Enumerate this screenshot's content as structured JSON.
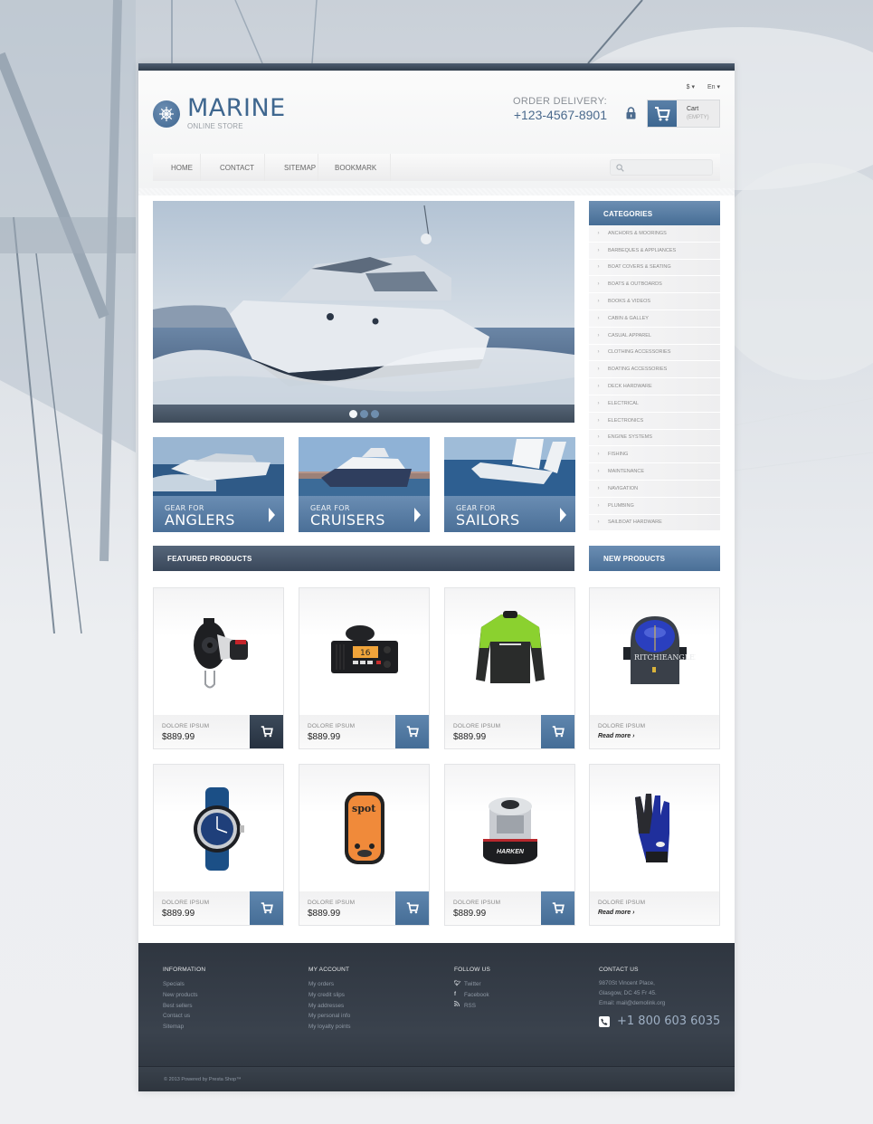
{
  "header": {
    "currency": "$",
    "language": "En",
    "logo_title": "MARINE",
    "logo_subtitle": "ONLINE STORE",
    "delivery_label": "ORDER DELIVERY:",
    "delivery_phone": "+123-4567-8901",
    "cart_label": "Cart",
    "cart_status": "(EMPTY)"
  },
  "nav": {
    "items": [
      "HOME",
      "CONTACT",
      "SITEMAP",
      "BOOKMARK"
    ],
    "search_placeholder": ""
  },
  "slider": {
    "slides": 3,
    "active_slide": 1
  },
  "banners": [
    {
      "small": "GEAR FOR",
      "big": "ANGLERS"
    },
    {
      "small": "GEAR FOR",
      "big": "CRUISERS"
    },
    {
      "small": "GEAR FOR",
      "big": "SAILORS"
    }
  ],
  "categories": {
    "title": "CATEGORIES",
    "items": [
      "ANCHORS & MOORINGS",
      "BARBEQUES & APPLIANCES",
      "BOAT COVERS & SEATING",
      "BOATS & OUTBOARDS",
      "BOOKS & VIDEOS",
      "CABIN & GALLEY",
      "CASUAL APPAREL",
      "CLOTHING ACCESSORIES",
      "BOATING ACCESSORIES",
      "DECK HARDWARE",
      "ELECTRICAL",
      "ELECTRONICS",
      "ENGINE SYSTEMS",
      "FISHING",
      "MAINTENANCE",
      "NAVIGATION",
      "PLUMBING",
      "SAILBOAT HARDWARE"
    ]
  },
  "featured": {
    "title": "FEATURED PRODUCTS",
    "products": [
      {
        "name": "DOLORE IPSUM",
        "price": "$889.99",
        "image": "block-pulley"
      },
      {
        "name": "DOLORE IPSUM",
        "price": "$889.99",
        "image": "vhf-radio"
      },
      {
        "name": "DOLORE IPSUM",
        "price": "$889.99",
        "image": "sailing-jacket"
      },
      {
        "name": "DOLORE IPSUM",
        "price": "$889.99",
        "image": "dive-watch"
      },
      {
        "name": "DOLORE IPSUM",
        "price": "$889.99",
        "image": "spot-gps-messenger"
      },
      {
        "name": "DOLORE IPSUM",
        "price": "$889.99",
        "image": "winch"
      }
    ]
  },
  "new_products": {
    "title": "NEW PRODUCTS",
    "products": [
      {
        "name": "DOLORE IPSUM",
        "link": "Read more ›",
        "image": "ritchie-compass"
      },
      {
        "name": "DOLORE IPSUM",
        "link": "Read more ›",
        "image": "gloves"
      }
    ]
  },
  "footer": {
    "information": {
      "title": "INFORMATION",
      "links": [
        "Specials",
        "New products",
        "Best sellers",
        "Contact us",
        "Sitemap"
      ]
    },
    "account": {
      "title": "MY ACCOUNT",
      "links": [
        "My orders",
        "My credit slips",
        "My addresses",
        "My personal info",
        "My loyalty points"
      ]
    },
    "follow": {
      "title": "FOLLOW US",
      "links": [
        {
          "icon": "twitter-icon",
          "label": "Twitter"
        },
        {
          "icon": "facebook-icon",
          "label": "Facebook"
        },
        {
          "icon": "rss-icon",
          "label": "RSS"
        }
      ]
    },
    "contact": {
      "title": "CONTACT US",
      "address_line1": "9870St Vincent Place,",
      "address_line2": "Glasgow, DC 45 Fr 45.",
      "email": "Email: mail@demolink.org",
      "phone": "+1 800 603 6035"
    },
    "copyright": "© 2013 Powered by Presta Shop™"
  },
  "colors": {
    "brand_blue": "#4a6f97",
    "dark_navy": "#39475a",
    "footer_bg": "#333b45"
  }
}
